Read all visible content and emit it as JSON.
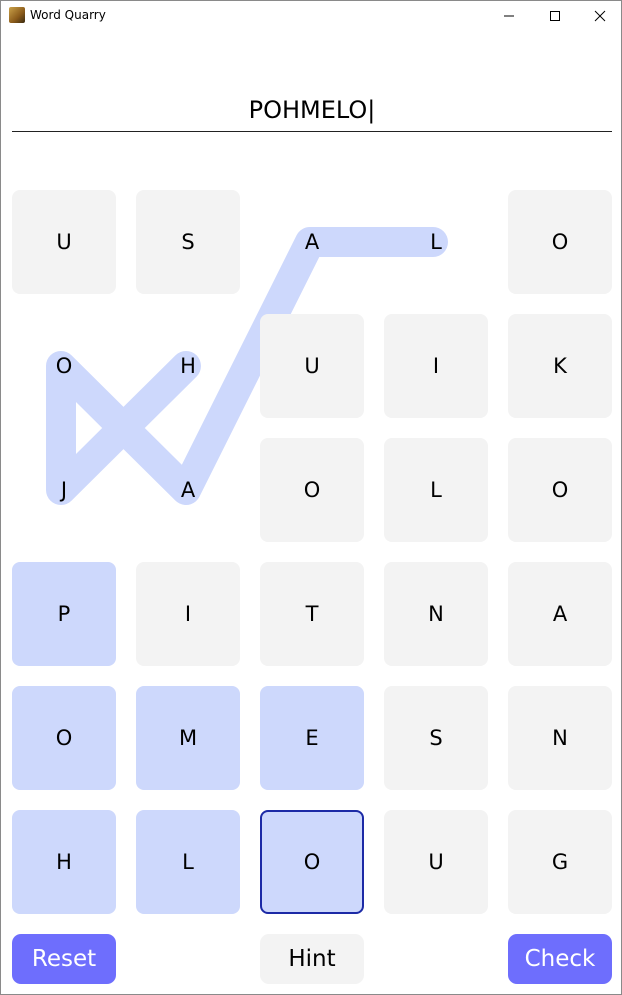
{
  "window": {
    "title": "Word Quarry"
  },
  "input": {
    "value": "POHMELO|"
  },
  "buttons": {
    "reset": "Reset",
    "hint": "Hint",
    "check": "Check"
  },
  "colors": {
    "accent": "#6e6efd",
    "selected_tile": "#cdd8fc",
    "current_border": "#1c2aa6",
    "tile": "#f3f3f3"
  },
  "grid": {
    "rows": [
      [
        {
          "letter": "U",
          "state": "normal"
        },
        {
          "letter": "S",
          "state": "normal"
        },
        {
          "letter": "A",
          "state": "gone"
        },
        {
          "letter": "L",
          "state": "gone"
        },
        {
          "letter": "O",
          "state": "normal"
        }
      ],
      [
        {
          "letter": "O",
          "state": "gone"
        },
        {
          "letter": "H",
          "state": "gone"
        },
        {
          "letter": "U",
          "state": "normal"
        },
        {
          "letter": "I",
          "state": "normal"
        },
        {
          "letter": "K",
          "state": "normal"
        }
      ],
      [
        {
          "letter": "J",
          "state": "gone"
        },
        {
          "letter": "A",
          "state": "gone"
        },
        {
          "letter": "O",
          "state": "normal"
        },
        {
          "letter": "L",
          "state": "normal"
        },
        {
          "letter": "O",
          "state": "normal"
        }
      ],
      [
        {
          "letter": "P",
          "state": "selected"
        },
        {
          "letter": "I",
          "state": "normal"
        },
        {
          "letter": "T",
          "state": "normal"
        },
        {
          "letter": "N",
          "state": "normal"
        },
        {
          "letter": "A",
          "state": "normal"
        }
      ],
      [
        {
          "letter": "O",
          "state": "selected"
        },
        {
          "letter": "M",
          "state": "selected"
        },
        {
          "letter": "E",
          "state": "selected"
        },
        {
          "letter": "S",
          "state": "normal"
        },
        {
          "letter": "N",
          "state": "normal"
        }
      ],
      [
        {
          "letter": "H",
          "state": "selected"
        },
        {
          "letter": "L",
          "state": "selected"
        },
        {
          "letter": "O",
          "state": "current"
        },
        {
          "letter": "U",
          "state": "normal"
        },
        {
          "letter": "G",
          "state": "normal"
        }
      ]
    ]
  }
}
